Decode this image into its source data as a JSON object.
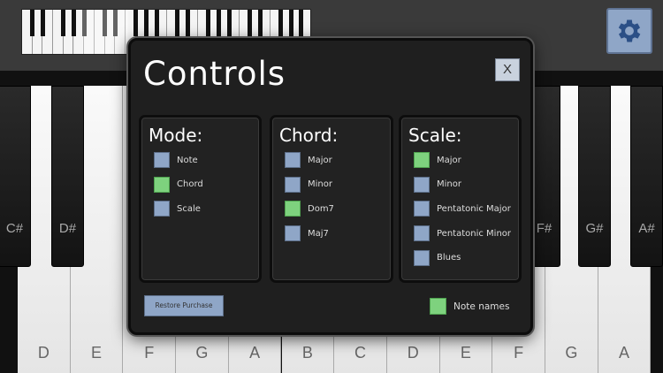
{
  "dialog": {
    "title": "Controls",
    "close_label": "X",
    "restore_label": "Restore Purchase",
    "note_names_label": "Note names",
    "note_names_checked": true
  },
  "mode": {
    "heading": "Mode:",
    "options": [
      {
        "label": "Note",
        "checked": false
      },
      {
        "label": "Chord",
        "checked": true
      },
      {
        "label": "Scale",
        "checked": false
      }
    ]
  },
  "chord": {
    "heading": "Chord:",
    "options": [
      {
        "label": "Major",
        "checked": false
      },
      {
        "label": "Minor",
        "checked": false
      },
      {
        "label": "Dom7",
        "checked": true
      },
      {
        "label": "Maj7",
        "checked": false
      }
    ]
  },
  "scale": {
    "heading": "Scale:",
    "options": [
      {
        "label": "Major",
        "checked": true
      },
      {
        "label": "Minor",
        "checked": false
      },
      {
        "label": "Pentatonic Major",
        "checked": false
      },
      {
        "label": "Pentatonic Minor",
        "checked": false
      },
      {
        "label": "Blues",
        "checked": false
      }
    ]
  },
  "piano": {
    "white_keys": [
      "D",
      "E",
      "F",
      "G",
      "A",
      "B",
      "C",
      "D",
      "E",
      "F",
      "G",
      "A"
    ],
    "black_keys_visible": [
      "C#",
      "D#",
      "F#",
      "G#",
      "A#"
    ]
  },
  "colors": {
    "checkbox_off": "#8fa6c7",
    "checkbox_on": "#7ed27e",
    "settings_button": "#8fa6c7"
  },
  "icons": {
    "settings": "gear-icon"
  }
}
